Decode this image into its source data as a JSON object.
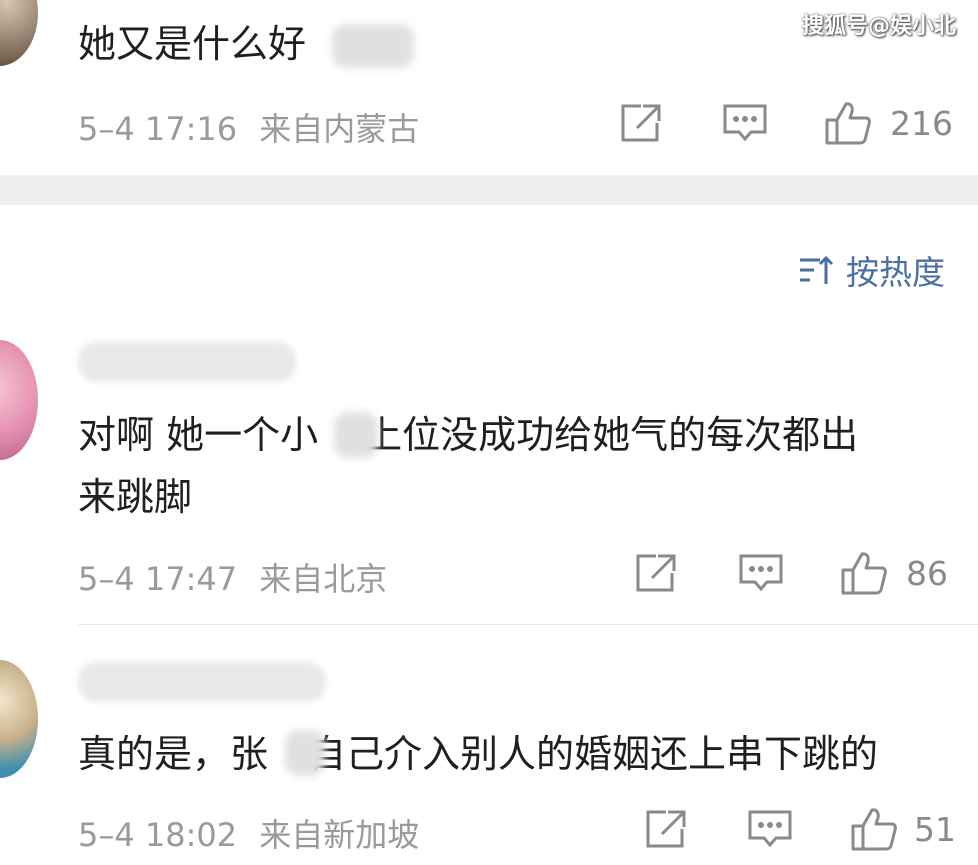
{
  "watermark": "搜狐号@娱小北",
  "sort": {
    "label": "按热度"
  },
  "comments": [
    {
      "text": "她又是什么好",
      "time": "5–4 17:16",
      "location": "来自内蒙古",
      "likes": "216"
    },
    {
      "text_line1_a": "对啊 她一个小",
      "text_line1_b": "上位没成功给她气的每次都出",
      "text_line2": "来跳脚",
      "time": "5–4 17:47",
      "location": "来自北京",
      "likes": "86"
    },
    {
      "text_a": "真的是，张",
      "text_b": "自己介入别人的婚姻还上串下跳的",
      "time": "5–4 18:02",
      "location": "来自新加坡",
      "likes": "51"
    }
  ],
  "icons": {
    "share": "share-icon",
    "reply": "comment-icon",
    "like": "thumbs-up-icon",
    "sort": "sort-icon"
  },
  "colors": {
    "accent": "#4a6fa5",
    "meta": "#9a9a9a",
    "band": "#efefef"
  }
}
